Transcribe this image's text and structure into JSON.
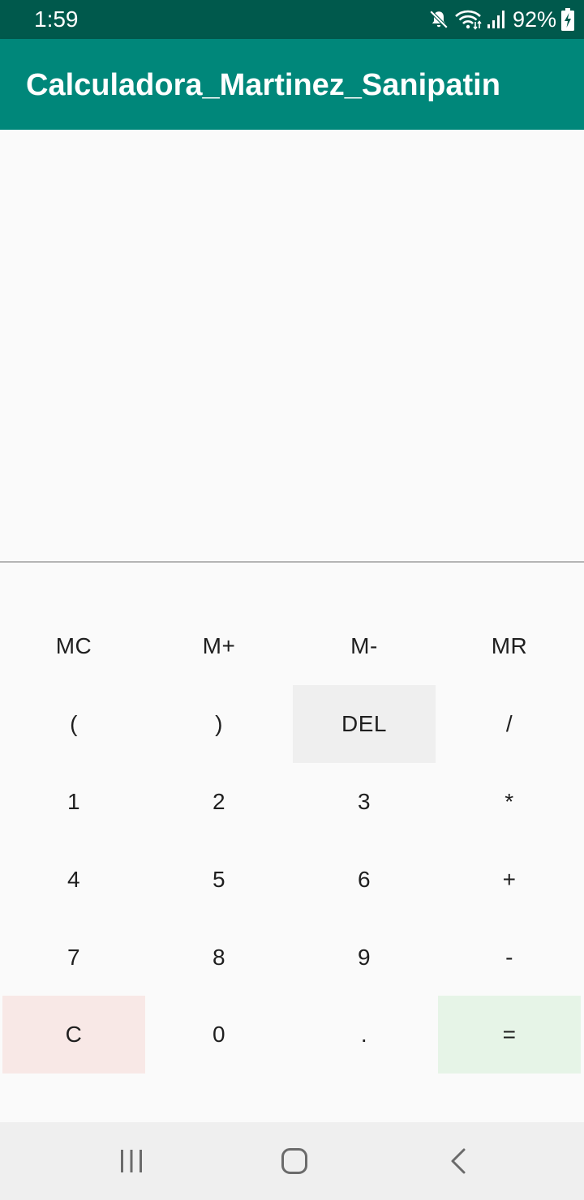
{
  "status_bar": {
    "time": "1:59",
    "battery": "92%",
    "icons": [
      "mute-icon",
      "wifi-icon",
      "signal-icon",
      "battery-charging-icon"
    ]
  },
  "app_bar": {
    "title": "Calculadora_Martinez_Sanipatin"
  },
  "colors": {
    "status_bar": "#00594c",
    "app_bar": "#00877a",
    "del_key": "#efefef",
    "clear_key": "#f8e8e6",
    "equals_key": "#e6f4e7"
  },
  "keypad": {
    "memory_row": [
      "MC",
      "M+",
      "M-",
      "MR"
    ],
    "row1": [
      "(",
      ")",
      "DEL",
      "/"
    ],
    "row2": [
      "1",
      "2",
      "3",
      "*"
    ],
    "row3": [
      "4",
      "5",
      "6",
      "+"
    ],
    "row4": [
      "7",
      "8",
      "9",
      "-"
    ],
    "row5": [
      "C",
      "0",
      ".",
      "="
    ]
  },
  "nav_bar": {
    "icons": [
      "recents-icon",
      "home-icon",
      "back-icon"
    ]
  }
}
